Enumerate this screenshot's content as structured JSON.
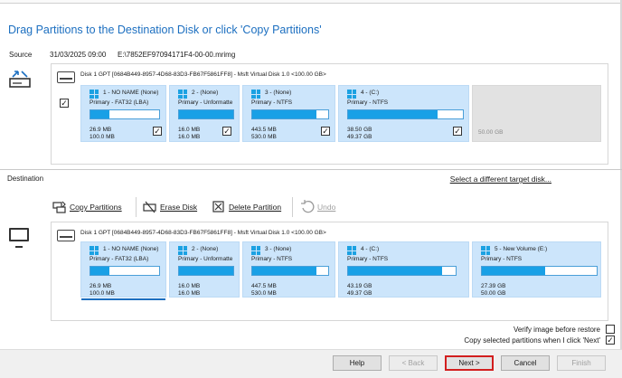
{
  "title": "Drag Partitions to the Destination Disk or click 'Copy Partitions'",
  "source": {
    "label": "Source",
    "date": "31/03/2025 09:00",
    "file": "E:\\7852EF97094171F4-00-00.mrimg",
    "disk": {
      "header": "Disk 1 GPT [0684B449-8957-4D68-83D3-FB67F5861FF8] - Msft       Virtual Disk       1.0   <100.00 GB>",
      "partitions": [
        {
          "name": "1 - NO NAME (None)",
          "type": "Primary - FAT32 (LBA)",
          "used": "26.9 MB",
          "total": "100.0 MB",
          "fill": 0.27,
          "checked": true
        },
        {
          "name": "2 -  (None)",
          "type": "Primary - Unformatte",
          "used": "16.0 MB",
          "total": "16.0 MB",
          "fill": 1.0,
          "checked": true
        },
        {
          "name": "3 -  (None)",
          "type": "Primary - NTFS",
          "used": "443.5 MB",
          "total": "530.0 MB",
          "fill": 0.84,
          "checked": true
        },
        {
          "name": "4 -  (C:)",
          "type": "Primary - NTFS",
          "used": "38.50 GB",
          "total": "49.37 GB",
          "fill": 0.78,
          "checked": true
        }
      ],
      "unallocated": "50.00 GB",
      "disk_checked": true
    }
  },
  "destination": {
    "label": "Destination",
    "select_link": "Select a different target disk...",
    "toolbar": {
      "copy": "Copy Partitions",
      "erase": "Erase Disk",
      "delete": "Delete Partition",
      "undo": "Undo"
    },
    "disk": {
      "header": "Disk 1 GPT [0684B449-8957-4D68-83D3-FB67F5861FF8] - Msft       Virtual Disk       1.0   <100.00 GB>",
      "partitions": [
        {
          "name": "1 - NO NAME (None)",
          "type": "Primary - FAT32 (LBA)",
          "used": "26.9 MB",
          "total": "100.0 MB",
          "fill": 0.27
        },
        {
          "name": "2 -  (None)",
          "type": "Primary - Unformatte",
          "used": "16.0 MB",
          "total": "16.0 MB",
          "fill": 1.0
        },
        {
          "name": "3 -  (None)",
          "type": "Primary - NTFS",
          "used": "447.5 MB",
          "total": "530.0 MB",
          "fill": 0.84
        },
        {
          "name": "4 -  (C:)",
          "type": "Primary - NTFS",
          "used": "43.19 GB",
          "total": "49.37 GB",
          "fill": 0.87
        },
        {
          "name": "5 - New Volume (E:)",
          "type": "Primary - NTFS",
          "used": "27.39 GB",
          "total": "50.00 GB",
          "fill": 0.55
        }
      ]
    }
  },
  "options": {
    "verify": "Verify image before restore",
    "verify_checked": false,
    "copy_selected": "Copy selected partitions when I click 'Next'",
    "copy_selected_checked": true
  },
  "buttons": {
    "help": "Help",
    "back": "< Back",
    "next": "Next >",
    "cancel": "Cancel",
    "finish": "Finish"
  },
  "colors": {
    "title": "#1c6fc0",
    "partition_bg": "#cce5fb",
    "bar_fill": "#19a0e6",
    "next_border": "#d21f1f"
  }
}
